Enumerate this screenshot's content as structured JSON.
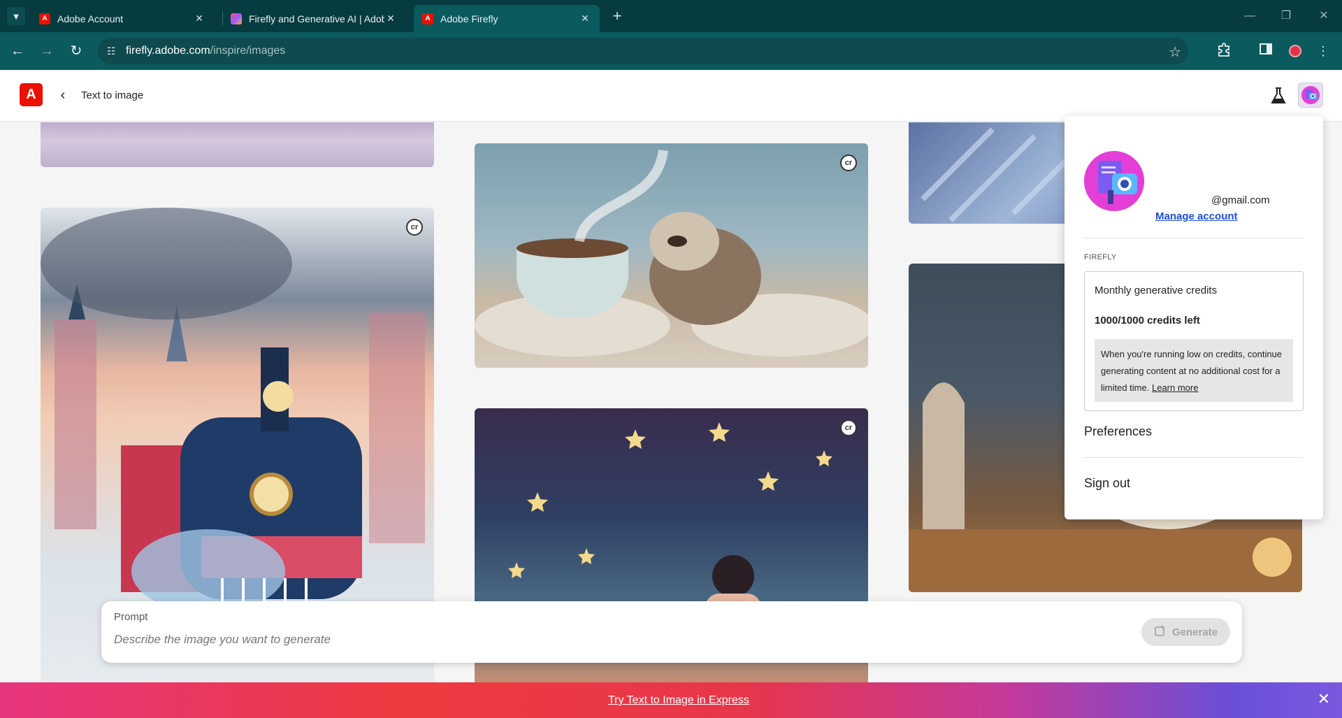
{
  "browser": {
    "tabs": [
      {
        "title": "Adobe Account",
        "icon": "adobe-icon",
        "active": false
      },
      {
        "title": "Firefly and Generative AI | Adobe C",
        "icon": "firefly-gradient-icon",
        "active": false
      },
      {
        "title": "Adobe Firefly",
        "icon": "adobe-icon",
        "active": true
      }
    ],
    "url_host": "firefly.adobe.com",
    "url_path": "/inspire/images",
    "profile_color": "#e3334a"
  },
  "app": {
    "page_title": "Text to image",
    "brand_color": "#eb1000",
    "logo_glyph": "A"
  },
  "gallery": {
    "badge_label": "cr"
  },
  "prompt": {
    "label": "Prompt",
    "placeholder": "Describe the image you want to generate",
    "generate_label": "Generate"
  },
  "banner": {
    "link_text": "Try Text to Image in Express"
  },
  "account_menu": {
    "email": "@gmail.com",
    "manage_account": "Manage account",
    "section_title": "FIREFLY",
    "credits_title": "Monthly generative credits",
    "credits_left": "1000/1000 credits left",
    "credits_note": "When you're running low on credits, continue generating content at no additional cost for a limited time.",
    "learn_more": "Learn more",
    "preferences": "Preferences",
    "sign_out": "Sign out"
  }
}
